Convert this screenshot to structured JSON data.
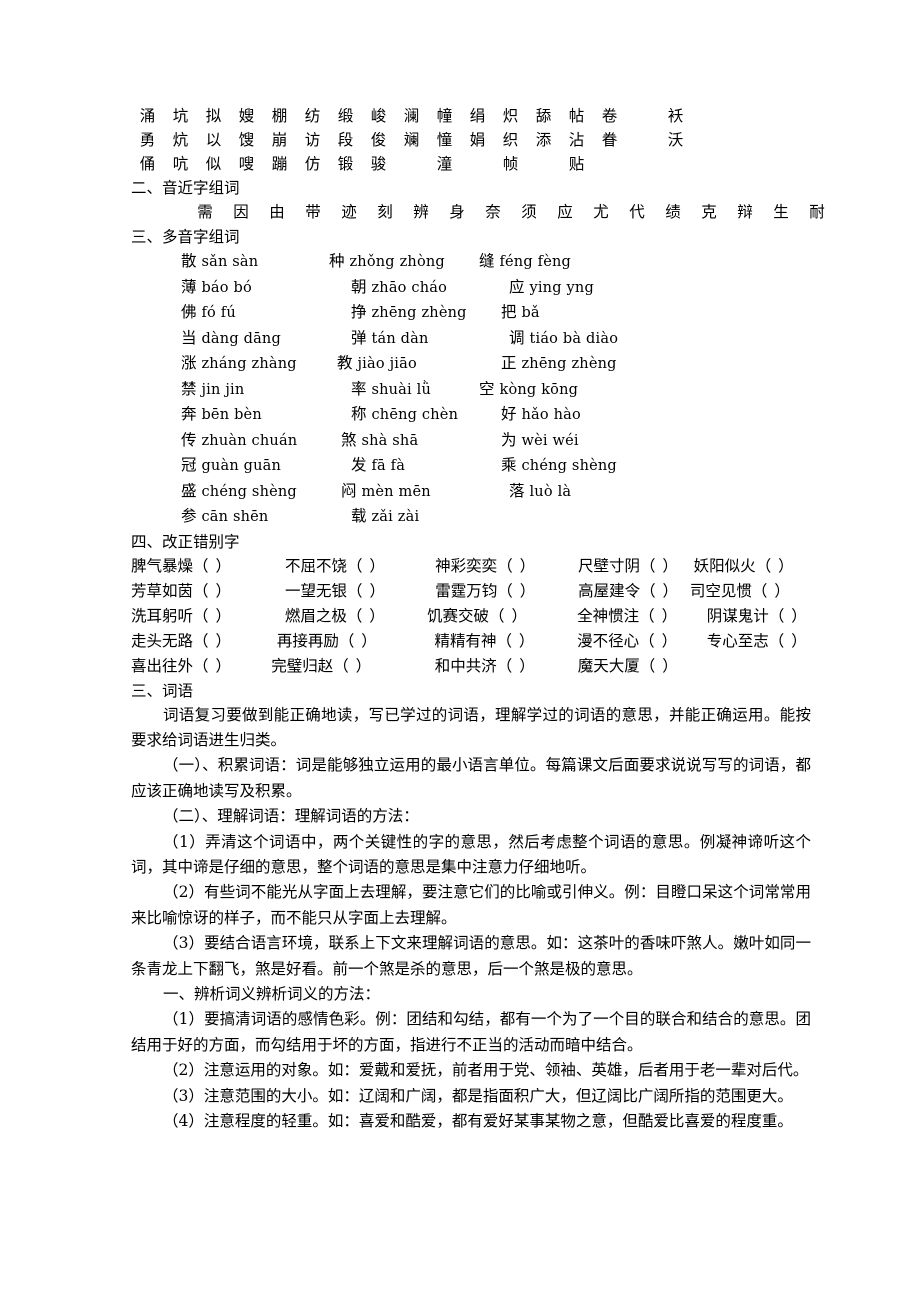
{
  "document": {
    "section_form_chars": {
      "rows": [
        [
          "涌",
          "坑",
          "拟",
          "嫂",
          "棚",
          "纺",
          "缎",
          "峻",
          "澜",
          "幢",
          "绢",
          "炽",
          "舔",
          "帖",
          "卷",
          "",
          "袄"
        ],
        [
          "勇",
          "炕",
          "以",
          "馊",
          "崩",
          "访",
          "段",
          "俊",
          "斓",
          "憧",
          "娟",
          "织",
          "添",
          "沾",
          "眷",
          "",
          "沃"
        ],
        [
          "俑",
          "吭",
          "似",
          "嗖",
          "蹦",
          "仿",
          "锻",
          "骏",
          "",
          "潼",
          "",
          "帧",
          "",
          "贴",
          "",
          "",
          ""
        ]
      ]
    },
    "section_two": {
      "heading": "二、音近字组词",
      "chars": [
        "需",
        "因",
        "由",
        "带",
        "迹",
        "刻",
        "辨",
        "身",
        "奈",
        "须",
        "应",
        "尤",
        "代",
        "绩",
        "克",
        "辩",
        "生",
        "耐"
      ]
    },
    "section_three": {
      "heading": "三、多音字组词",
      "rows": [
        [
          {
            "han": "散",
            "py": "sǎn sàn"
          },
          {
            "han": "种",
            "py": "zhǒng zhòng"
          },
          {
            "han": "缝",
            "py": "féng fèng"
          }
        ],
        [
          {
            "han": "薄",
            "py": "báo bó"
          },
          {
            "han": "朝",
            "py": "zhāo cháo"
          },
          {
            "han": "应",
            "py": "ying yng"
          }
        ],
        [
          {
            "han": "佛",
            "py": "fó  fú"
          },
          {
            "han": "挣",
            "py": "zhēng zhèng"
          },
          {
            "han": "把",
            "py": "bǎ"
          }
        ],
        [
          {
            "han": "当",
            "py": "dàng dāng"
          },
          {
            "han": "弹",
            "py": "tán dàn"
          },
          {
            "han": "调",
            "py": "tiáo bà  diào"
          }
        ],
        [
          {
            "han": "涨",
            "py": "zháng zhàng"
          },
          {
            "han": "教",
            "py": "jiào jiāo"
          },
          {
            "han": "正",
            "py": "zhēng zhèng"
          }
        ],
        [
          {
            "han": "禁",
            "py": "jin jin"
          },
          {
            "han": "率",
            "py": "shuài lǜ"
          },
          {
            "han": "空",
            "py": "kòng kōng"
          }
        ],
        [
          {
            "han": "奔",
            "py": "bēn bèn"
          },
          {
            "han": "称",
            "py": "chēng chèn"
          },
          {
            "han": "好",
            "py": "hǎo hào"
          }
        ],
        [
          {
            "han": "传",
            "py": "zhuàn chuán"
          },
          {
            "han": "煞",
            "py": "shà  shā"
          },
          {
            "han": "为",
            "py": "wèi wéi"
          }
        ],
        [
          {
            "han": "冠",
            "py": "guàn guān"
          },
          {
            "han": "发",
            "py": "fā  fà"
          },
          {
            "han": "乘",
            "py": "chéng shèng"
          }
        ],
        [
          {
            "han": "盛",
            "py": "chéng shèng"
          },
          {
            "han": "闷",
            "py": "mèn mēn"
          },
          {
            "han": "落",
            "py": "luò  là"
          }
        ],
        [
          {
            "han": "参",
            "py": "cān shēn"
          },
          {
            "han": "载",
            "py": "zǎi zài"
          },
          {
            "han": "",
            "py": ""
          }
        ]
      ]
    },
    "section_four": {
      "heading": "四、改正错别字",
      "bracket": "（   ）",
      "rows": [
        [
          "脾气暴燥",
          "不屈不饶",
          "神彩奕奕",
          "尺壁寸阴",
          "妖阳似火"
        ],
        [
          "芳草如茵",
          "一望无银",
          "雷霆万钧",
          "高屋建令",
          "司空见惯"
        ],
        [
          "洗耳躬听",
          "燃眉之极",
          "饥赛交破",
          "全神惯注",
          "阴谋鬼计"
        ],
        [
          "走头无路",
          "再接再励",
          "精精有神",
          "漫不径心",
          "专心至志"
        ],
        [
          "喜出往外",
          "完璧归赵",
          "和中共济",
          "魔天大厦",
          ""
        ]
      ]
    },
    "section_vocab": {
      "heading": "三、词语",
      "paragraphs": [
        "词语复习要做到能正确地读，写已学过的词语，理解学过的词语的意思，并能正确运用。能按要求给词语进生归类。",
        "（一）、积累词语：词是能够独立运用的最小语言单位。每篇课文后面要求说说写写的词语，都应该正确地读写及积累。",
        "（二）、理解词语：理解词语的方法：",
        "（1）弄清这个词语中，两个关键性的字的意思，然后考虑整个词语的意思。例凝神谛听这个词，其中谛是仔细的意思，整个词语的意思是集中注意力仔细地听。",
        "（2）有些词不能光从字面上去理解，要注意它们的比喻或引伸义。例：目瞪口呆这个词常常用来比喻惊讶的样子，而不能只从字面上去理解。",
        "（3）要结合语言环境，联系上下文来理解词语的意思。如：这茶叶的香味吓煞人。嫩叶如同一条青龙上下翻飞，煞是好看。前一个煞是杀的意思，后一个煞是极的意思。",
        "一、辨析词义辨析词义的方法：",
        "（1）要搞清词语的感情色彩。例：团结和勾结，都有一个为了一个目的联合和结合的意思。团结用于好的方面，而勾结用于坏的方面，指进行不正当的活动而暗中结合。",
        "（2）注意运用的对象。如：爱戴和爱抚，前者用于党、领袖、英雄，后者用于老一辈对后代。",
        "（3）注意范围的大小。如：辽阔和广阔，都是指面积广大，但辽阔比广阔所指的范围更大。",
        "（4）注意程度的轻重。如：喜爱和酷爱，都有爱好某事某物之意，但酷爱比喜爱的程度重。"
      ]
    }
  }
}
